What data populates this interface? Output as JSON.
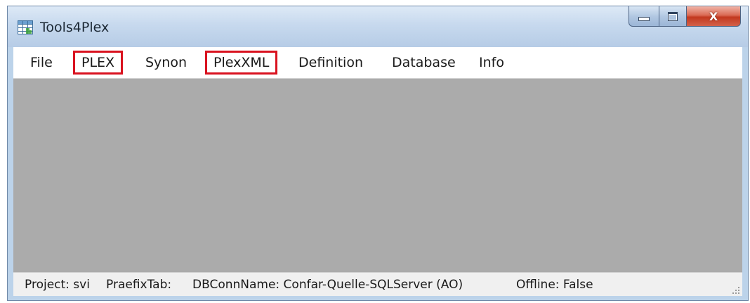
{
  "window": {
    "title": "Tools4Plex",
    "app_icon": "table-grid-icon",
    "controls": {
      "minimize_icon": "minimize-icon",
      "maximize_icon": "maximize-icon",
      "close_icon": "close-icon",
      "close_glyph": "X"
    }
  },
  "menu": {
    "items": [
      {
        "label": "File"
      },
      {
        "label": "PLEX",
        "highlighted": true
      },
      {
        "label": "Synon"
      },
      {
        "label": "PlexXML",
        "highlighted": true
      },
      {
        "label": "Definition"
      },
      {
        "label": "Database"
      },
      {
        "label": "Info"
      }
    ],
    "highlight_color": "#d9121f"
  },
  "content": {
    "background": "#ababab"
  },
  "status": {
    "project": "Project: svi",
    "praefix_tab": "PraefixTab:",
    "db_conn_name": "DBConnName: Confar-Quelle-SQLServer (AO)",
    "offline": "Offline: False",
    "grip_icon": "resize-grip-icon"
  }
}
